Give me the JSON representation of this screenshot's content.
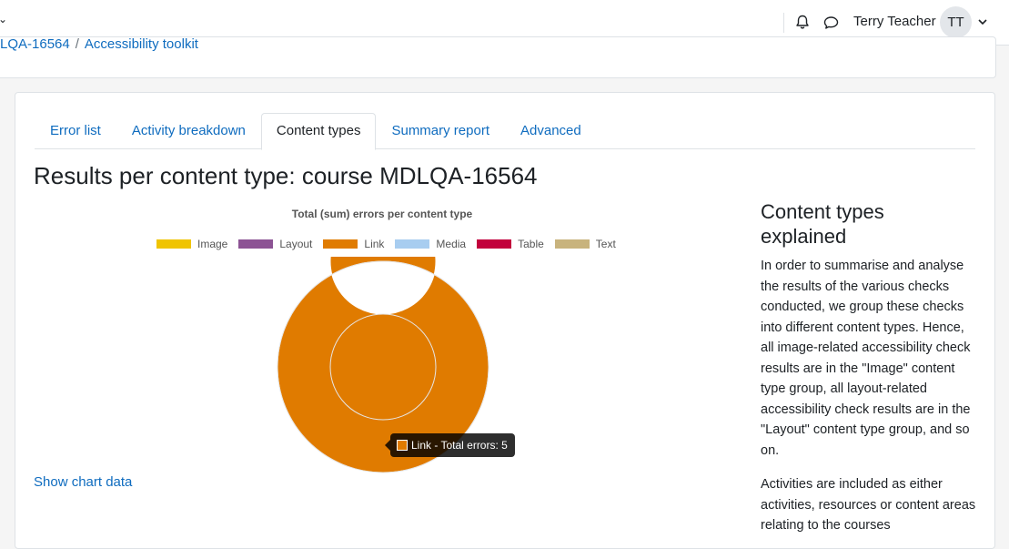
{
  "topbar": {
    "username": "Terry Teacher",
    "avatar_initials": "TT"
  },
  "breadcrumb": {
    "course": "LQA-16564",
    "page": "Accessibility toolkit"
  },
  "tabs": [
    {
      "label": "Error list"
    },
    {
      "label": "Activity breakdown"
    },
    {
      "label": "Content types"
    },
    {
      "label": "Summary report"
    },
    {
      "label": "Advanced"
    }
  ],
  "active_tab": "Content types",
  "page_title": "Results per content type: course MDLQA-16564",
  "chart_data": {
    "type": "pie",
    "variant": "doughnut",
    "title": "Total (sum) errors per content type",
    "legend_position": "top",
    "categories": [
      "Image",
      "Layout",
      "Link",
      "Media",
      "Table",
      "Text"
    ],
    "colors": [
      "#f0c400",
      "#8c5394",
      "#e07b00",
      "#a8cdf0",
      "#c2003c",
      "#c8b37d"
    ],
    "values": [
      0,
      0,
      5,
      0,
      0,
      0
    ],
    "tooltip": {
      "label": "Link - Total errors: 5",
      "color": "#e07b00"
    }
  },
  "show_chart_data_link": "Show chart data",
  "sidebar": {
    "heading": "Content types explained",
    "paragraph1": "In order to summarise and analyse the results of the various checks conducted, we group these checks into different content types. Hence, all image-related accessibility check results are in the \"Image\" content type group, all layout-related accessibility check results are in the \"Layout\" content type group, and so on.",
    "paragraph2": "Activities are included as either activities, resources or content areas relating to the courses"
  }
}
